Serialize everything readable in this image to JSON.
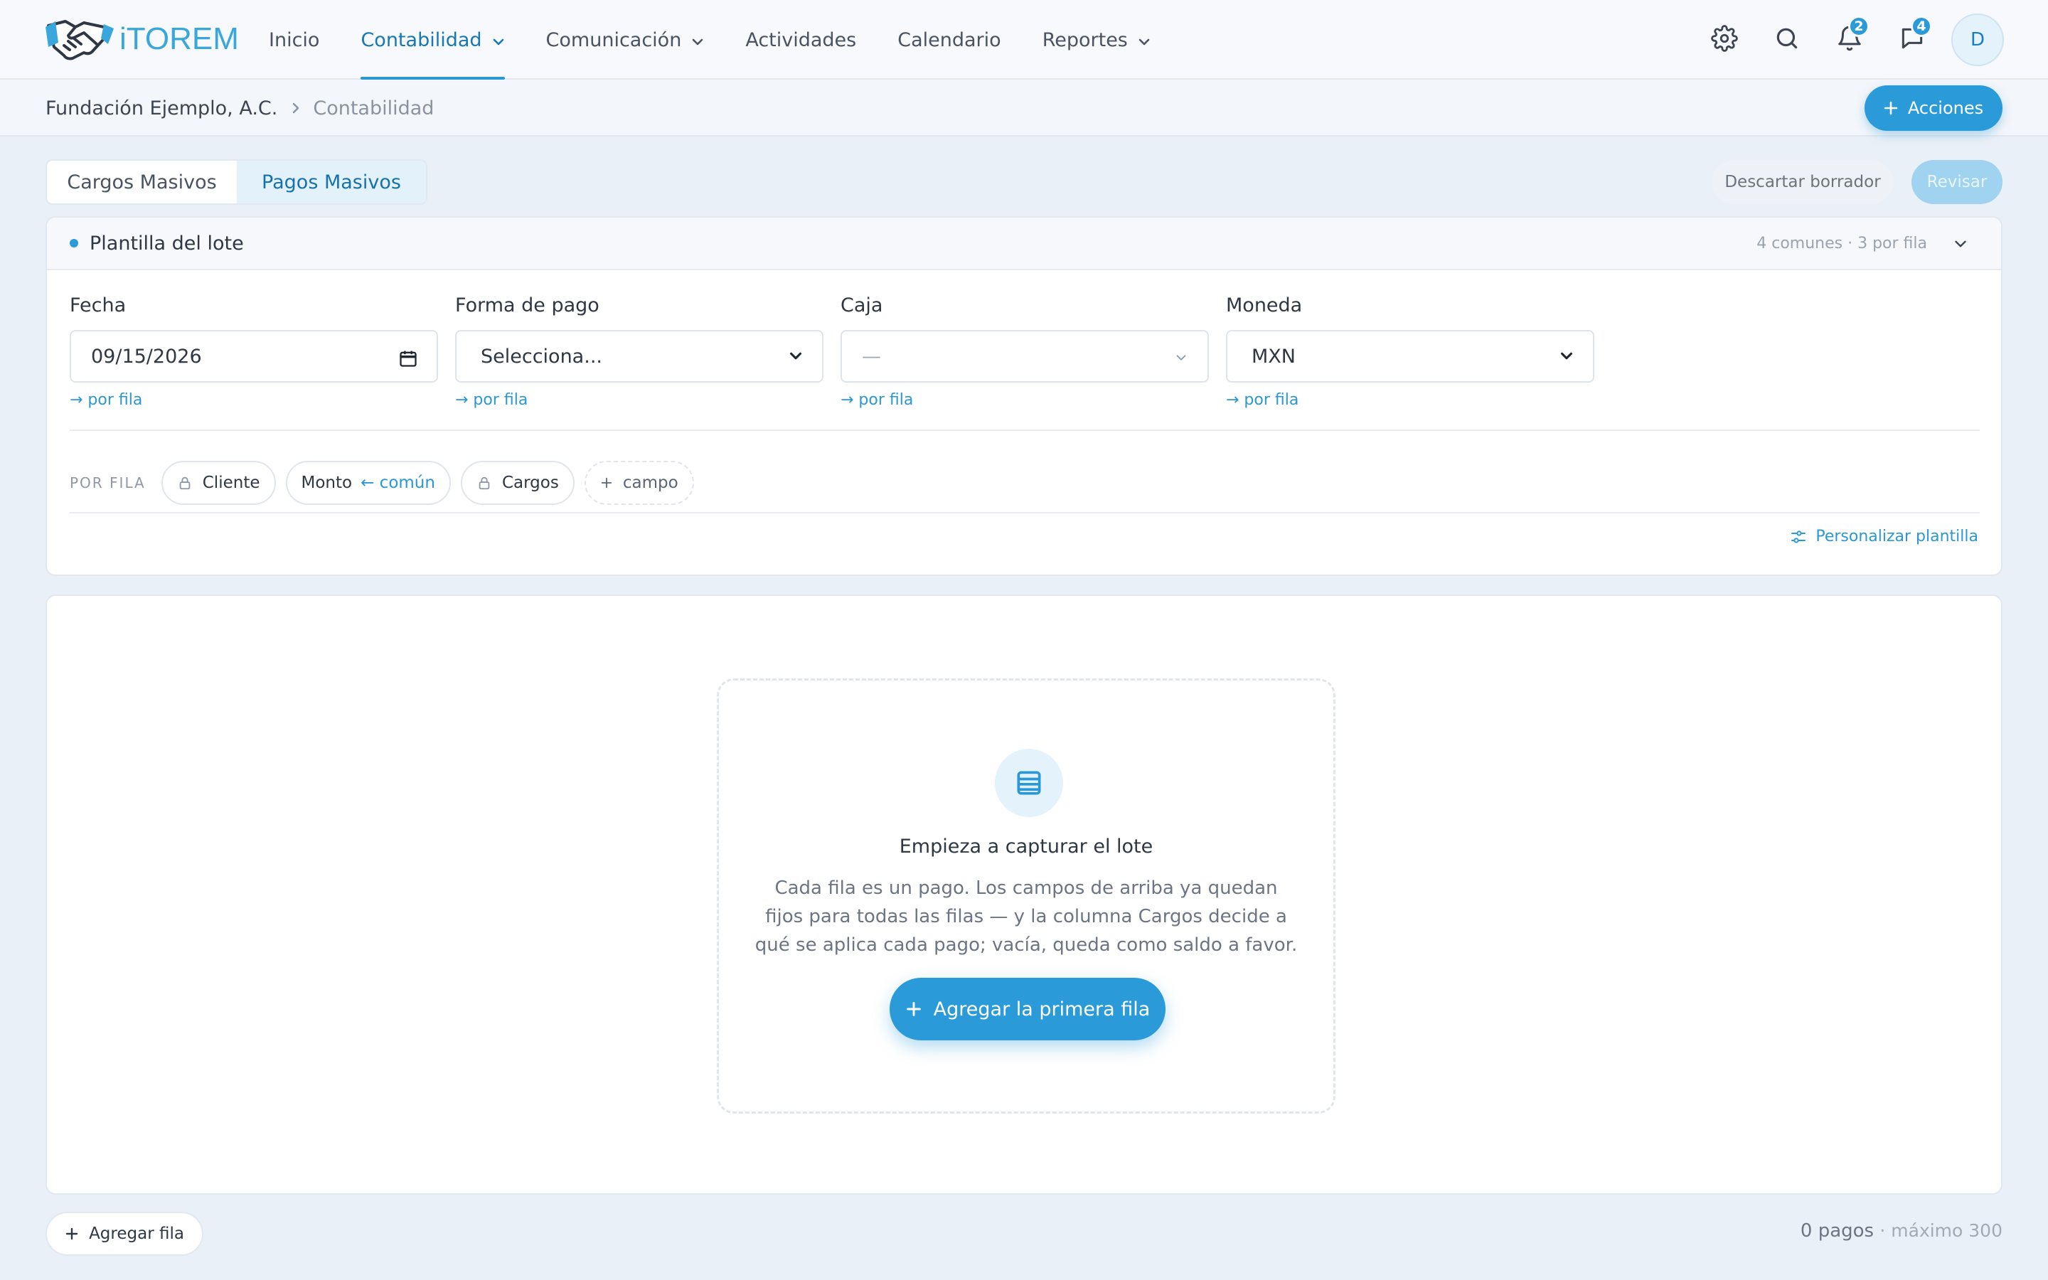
{
  "app": {
    "logo_text": "iTOREM"
  },
  "nav": {
    "items": [
      {
        "label": "Inicio",
        "active": false,
        "dropdown": false
      },
      {
        "label": "Contabilidad",
        "active": true,
        "dropdown": true
      },
      {
        "label": "Comunicación",
        "active": false,
        "dropdown": true
      },
      {
        "label": "Actividades",
        "active": false,
        "dropdown": false
      },
      {
        "label": "Calendario",
        "active": false,
        "dropdown": false
      },
      {
        "label": "Reportes",
        "active": false,
        "dropdown": true
      }
    ],
    "icons": [
      "gear-icon",
      "search-icon",
      "bell-icon",
      "chat-icon"
    ],
    "notifications_badge": "2",
    "messages_badge": "4",
    "avatar_initial": "D"
  },
  "breadcrumb": {
    "org": "Fundación Ejemplo, A.C.",
    "section": "Contabilidad"
  },
  "actions_button": "Acciones",
  "tabs": [
    {
      "label": "Cargos Masivos",
      "active": false
    },
    {
      "label": "Pagos Masivos",
      "active": true
    }
  ],
  "toolbar": {
    "discard_label": "Descartar borrador",
    "review_label": "Revisar"
  },
  "template": {
    "title": "Plantilla del lote",
    "meta": "4 comunes · 3 por fila",
    "fields": [
      {
        "label": "Fecha",
        "value": "09/15/2026",
        "per_row": "→ por fila"
      },
      {
        "label": "Forma de pago",
        "value": "Selecciona...",
        "per_row": "→ por fila"
      },
      {
        "label": "Caja",
        "value": "—",
        "per_row": "→ por fila"
      },
      {
        "label": "Moneda",
        "value": "MXN",
        "per_row": "→ por fila"
      }
    ],
    "per_row_label": "POR FILA",
    "chips": {
      "cliente": "Cliente",
      "monto": "Monto",
      "monto_common": "← común",
      "cargos": "Cargos",
      "add_field": "campo"
    },
    "customize": "Personalizar plantilla"
  },
  "empty_state": {
    "title": "Empieza a capturar el lote",
    "description": "Cada fila es un pago. Los campos de arriba ya quedan fijos para todas las filas — y la columna Cargos decide a qué se aplica cada pago; vacía, queda como saldo a favor.",
    "button": "Agregar la primera fila"
  },
  "footer": {
    "add_row": "Agregar fila",
    "count": "0 pagos",
    "max": "· máximo 300"
  },
  "colors": {
    "accent": "#2a9bd8",
    "active_text": "#1572ad",
    "background": "#eaf0f7"
  }
}
